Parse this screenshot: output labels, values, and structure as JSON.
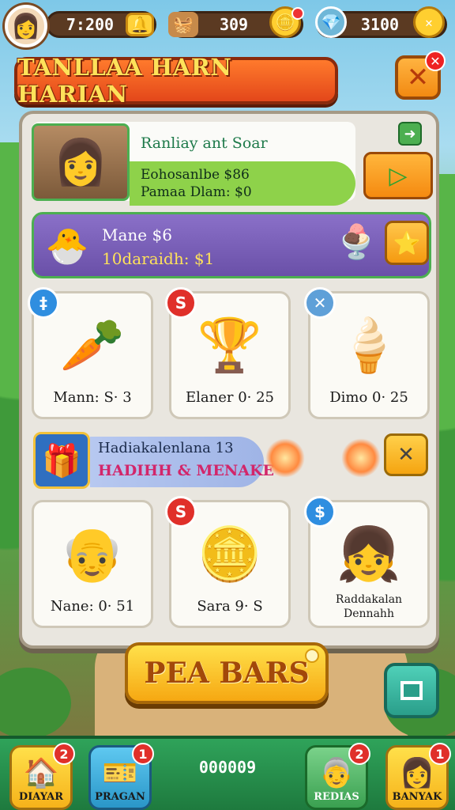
{
  "hud": {
    "avatar": "girl-avatar",
    "coins": "7:200",
    "currency2": "309",
    "currency3": "3100"
  },
  "title": "TANLLAA HARN HARIAN",
  "featured": {
    "name": "Ranliay ant Soar",
    "line1": "Eohosanlbe $86",
    "line2": "Pamaa Dlam: $0"
  },
  "promo": {
    "line1": "Mane $6",
    "line2": "10daraidh: $1"
  },
  "tiles_row1": [
    {
      "caption": "Mann: S· 3",
      "badge": "‡",
      "icon": "radish-icon"
    },
    {
      "caption": "Elaner 0· 25",
      "badge": "S",
      "icon": "golden-cup-icon"
    },
    {
      "caption": "Dimo 0· 25",
      "badge": "✕",
      "icon": "ice-cream-cone-icon"
    }
  ],
  "event": {
    "line1": "Hadiakalenlana 13",
    "line2": "HADIHH & MENAKE"
  },
  "tiles_row2": [
    {
      "caption": "Nane: 0· 51",
      "badge": "",
      "icon": "elder-character-icon"
    },
    {
      "caption": "Sara 9· S",
      "badge": "S",
      "icon": "gold-coin-icon"
    },
    {
      "caption": "Raddakalan\nDennahh",
      "caption_l1": "Raddakalan",
      "caption_l2": "Dennahh",
      "badge": "$",
      "icon": "girl-character-icon"
    }
  ],
  "cta": "PEA BARS",
  "nav": {
    "home": {
      "label": "DIAYAR",
      "count": "2"
    },
    "pragan": {
      "label": "PRAGAN",
      "count": "1"
    },
    "center": "000009",
    "readias": {
      "label": "REDIAS",
      "count": "2"
    },
    "banyak": {
      "label": "BANYAK",
      "count": "1"
    }
  }
}
